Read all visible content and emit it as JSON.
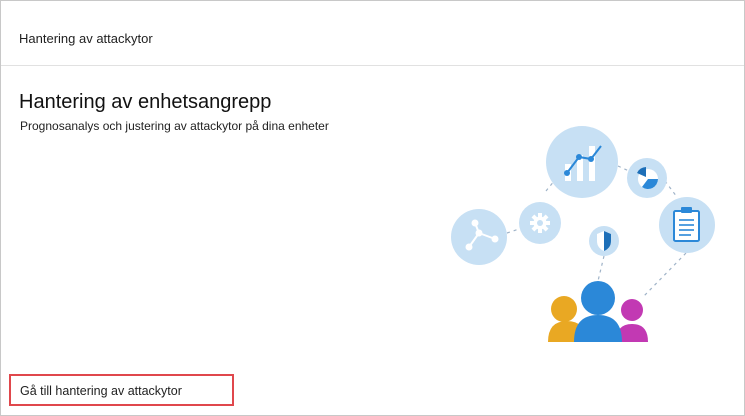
{
  "header": {
    "title": "Hantering av attackytor"
  },
  "main": {
    "title": "Hantering av enhetsangrepp",
    "subtitle": "Prognosanalys och justering av attackytor på dina enheter",
    "cta_label": "Gå till hantering av attackytor"
  },
  "illustration": {
    "icons": [
      "bar-chart-icon",
      "pie-chart-icon",
      "gear-icon",
      "network-icon",
      "shield-icon",
      "clipboard-icon",
      "people-icon"
    ],
    "colors": {
      "bubble": "#c7e0f4",
      "accent_blue": "#2b88d8",
      "dark_blue": "#1d6fb8",
      "orange": "#e9a823",
      "magenta": "#c239b3"
    }
  }
}
